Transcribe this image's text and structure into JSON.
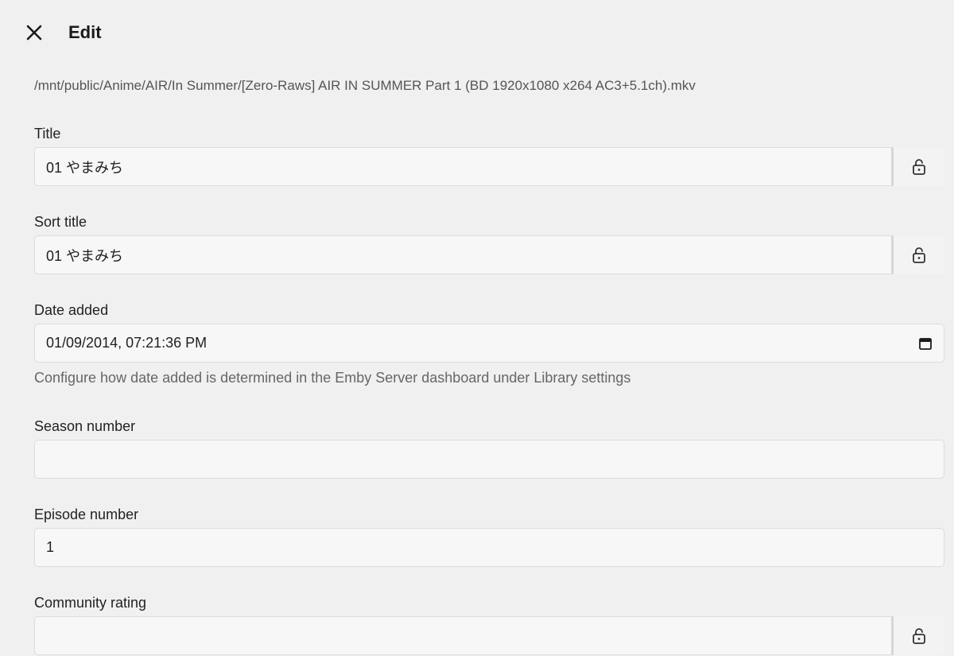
{
  "header": {
    "close_icon": "close-icon",
    "title": "Edit"
  },
  "file_path": "/mnt/public/Anime/AIR/In Summer/[Zero-Raws] AIR IN SUMMER Part 1 (BD 1920x1080 x264 AC3+5.1ch).mkv",
  "fields": {
    "title": {
      "label": "Title",
      "value": "01 やまみち",
      "lock_icon": "lock-open-icon"
    },
    "sort_title": {
      "label": "Sort title",
      "value": "01 やまみち",
      "lock_icon": "lock-open-icon"
    },
    "date_added": {
      "label": "Date added",
      "value": "01/09/2014, 07:21:36 PM",
      "calendar_icon": "calendar-icon",
      "hint": "Configure how date added is determined in the Emby Server dashboard under Library settings"
    },
    "season_number": {
      "label": "Season number",
      "value": ""
    },
    "episode_number": {
      "label": "Episode number",
      "value": "1"
    },
    "community_rating": {
      "label": "Community rating",
      "value": "",
      "lock_icon": "lock-open-icon"
    }
  }
}
